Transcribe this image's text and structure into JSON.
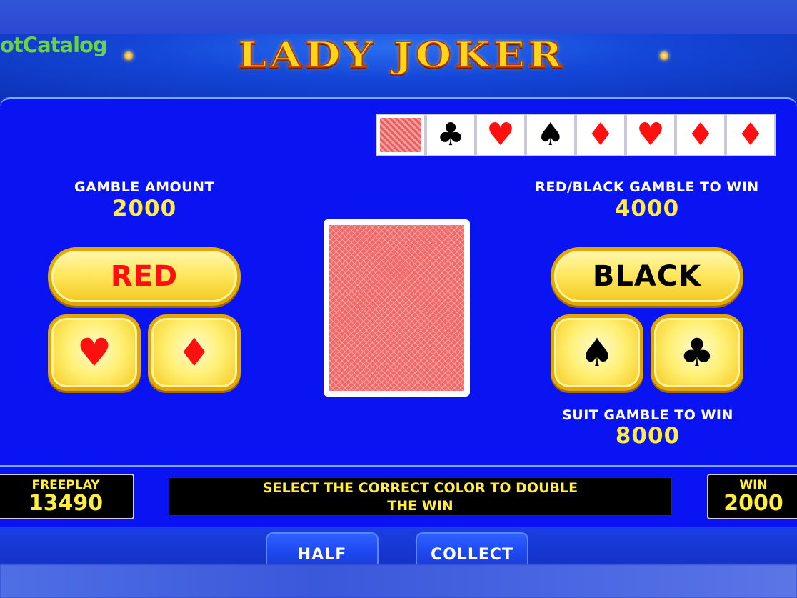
{
  "watermark": "otCatalog",
  "title": "LADY JOKER",
  "history": [
    {
      "type": "back"
    },
    {
      "suit": "♣",
      "color": "black",
      "name": "club"
    },
    {
      "suit": "♥",
      "color": "red",
      "name": "heart"
    },
    {
      "suit": "♠",
      "color": "black",
      "name": "spade"
    },
    {
      "suit": "♦",
      "color": "red",
      "name": "diamond"
    },
    {
      "suit": "♥",
      "color": "red",
      "name": "heart"
    },
    {
      "suit": "♦",
      "color": "red",
      "name": "diamond"
    },
    {
      "suit": "♦",
      "color": "red",
      "name": "diamond"
    }
  ],
  "gamble_amount": {
    "label": "GAMBLE AMOUNT",
    "value": "2000"
  },
  "red_black": {
    "label": "RED/BLACK GAMBLE TO WIN",
    "value": "4000"
  },
  "suit_gamble": {
    "label": "SUIT GAMBLE TO WIN",
    "value": "8000"
  },
  "buttons": {
    "red": "RED",
    "black": "BLACK",
    "heart": "♥",
    "diamond": "♦",
    "spade": "♠",
    "club": "♣",
    "half": "HALF",
    "collect": "COLLECT"
  },
  "freeplay": {
    "label": "FREEPLAY",
    "value": "13490"
  },
  "win": {
    "label": "WIN",
    "value": "2000"
  },
  "message": {
    "line1": "SELECT THE CORRECT COLOR TO DOUBLE",
    "line2": "THE WIN"
  },
  "colors": {
    "red": "#ff1010",
    "black": "#000000",
    "accent_yellow": "#ffee40",
    "panel_blue": "#0a14f2"
  }
}
